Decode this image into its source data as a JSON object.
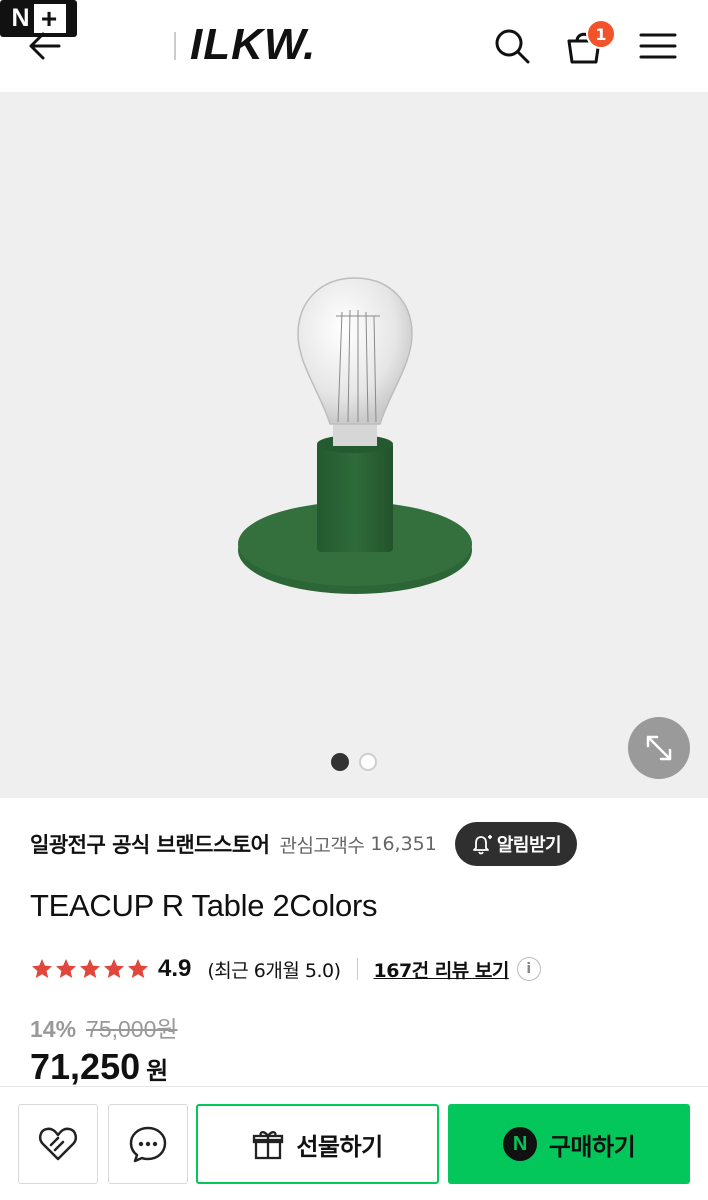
{
  "header": {
    "nplus_logo": "N+",
    "brand_logo": "ILKW.",
    "cart_count": "1",
    "icons": [
      "back-arrow-icon",
      "search-icon",
      "shopping-bag-icon",
      "hamburger-menu-icon"
    ]
  },
  "gallery": {
    "image_count": 2,
    "active_index": 0,
    "zoom_icon": "expand-arrows-icon"
  },
  "store": {
    "name": "일광전구 공식 브랜드스토어",
    "followers_label": "관심고객수",
    "followers_count": "16,351",
    "notify_label": "알림받기"
  },
  "product": {
    "title": "TEACUP R Table 2Colors",
    "rating_stars": 5,
    "rating": "4.9",
    "recent_rating": "(최근 6개월 5.0)",
    "reviews_link": "167건 리뷰 보기",
    "discount": "14%",
    "original_price": "75,000원",
    "price": "71,250",
    "currency": "원"
  },
  "bottom_bar": {
    "gift_label": "선물하기",
    "buy_label": "구매하기",
    "buy_icon_letter": "N"
  },
  "colors": {
    "accent_green": "#03c75a",
    "star_red": "#e0463c",
    "badge_orange": "#f3532b",
    "product_green": "#2f6b3a"
  }
}
